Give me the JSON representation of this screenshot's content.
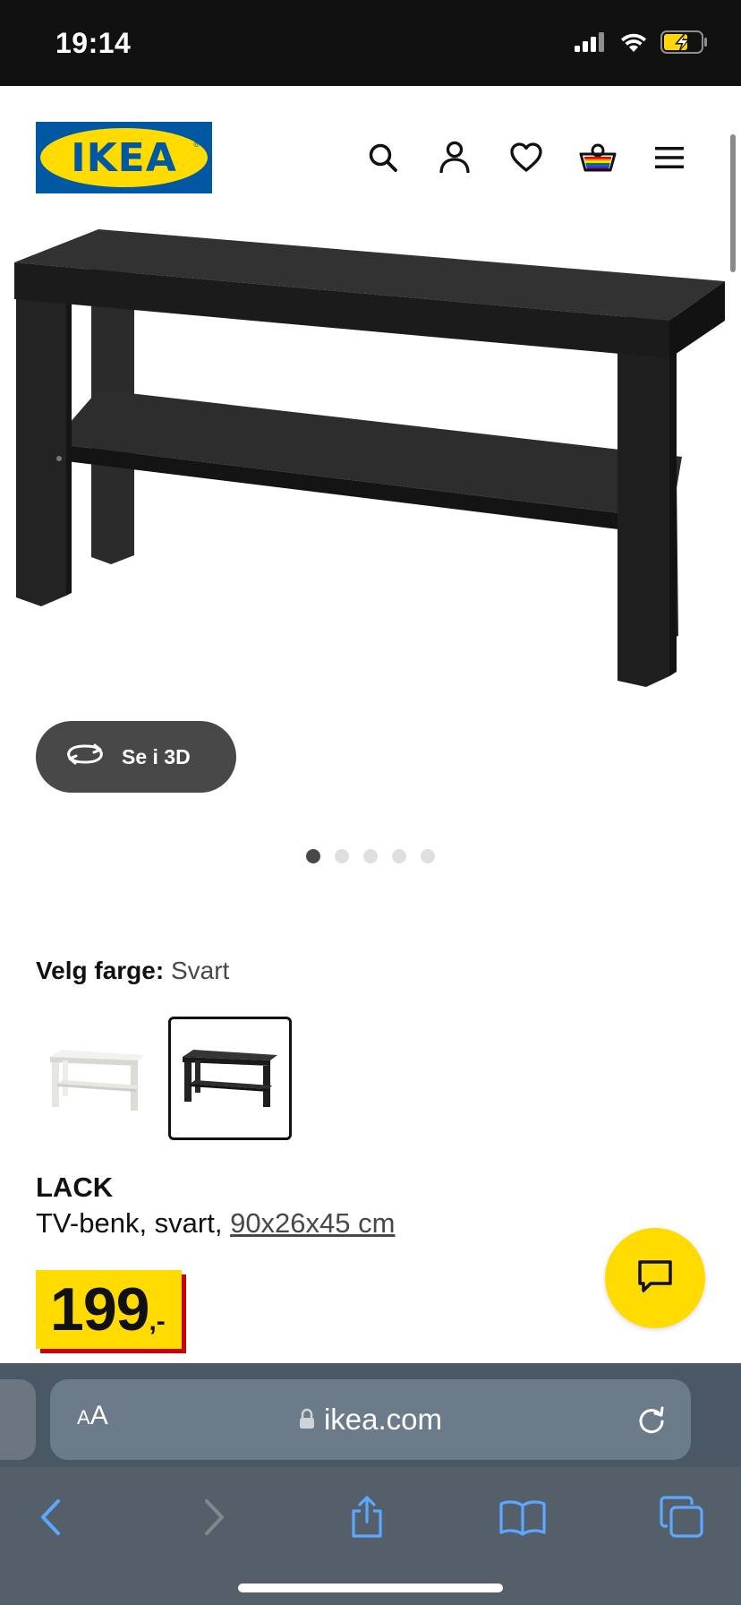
{
  "status_bar": {
    "time": "19:14",
    "icons": [
      "signal-icon",
      "wifi-icon",
      "battery-charging-icon"
    ]
  },
  "header": {
    "logo_text": "IKEA",
    "icons": [
      "search-icon",
      "account-icon",
      "heart-icon",
      "basket-icon",
      "menu-icon"
    ]
  },
  "gallery": {
    "view_3d_label": "Se i 3D",
    "total_images": 5,
    "active_index": 0
  },
  "color_picker": {
    "label": "Velg farge:",
    "selected_value": "Svart",
    "options": [
      {
        "color": "white",
        "selected": false
      },
      {
        "color": "black",
        "selected": true
      }
    ]
  },
  "product": {
    "name": "LACK",
    "description_prefix": "TV-benk, svart, ",
    "dimensions": "90x26x45 cm",
    "price_main": "199",
    "price_suffix": ",-"
  },
  "colors": {
    "ikea_blue": "#0058a3",
    "ikea_yellow": "#ffdb00",
    "price_shadow": "#cc0008",
    "safari_bar": "#4a5764"
  },
  "browser": {
    "text_size_label": "AA",
    "url": "ikea.com",
    "toolbar": [
      "back-icon",
      "forward-icon",
      "share-icon",
      "bookmarks-icon",
      "tabs-icon"
    ]
  }
}
